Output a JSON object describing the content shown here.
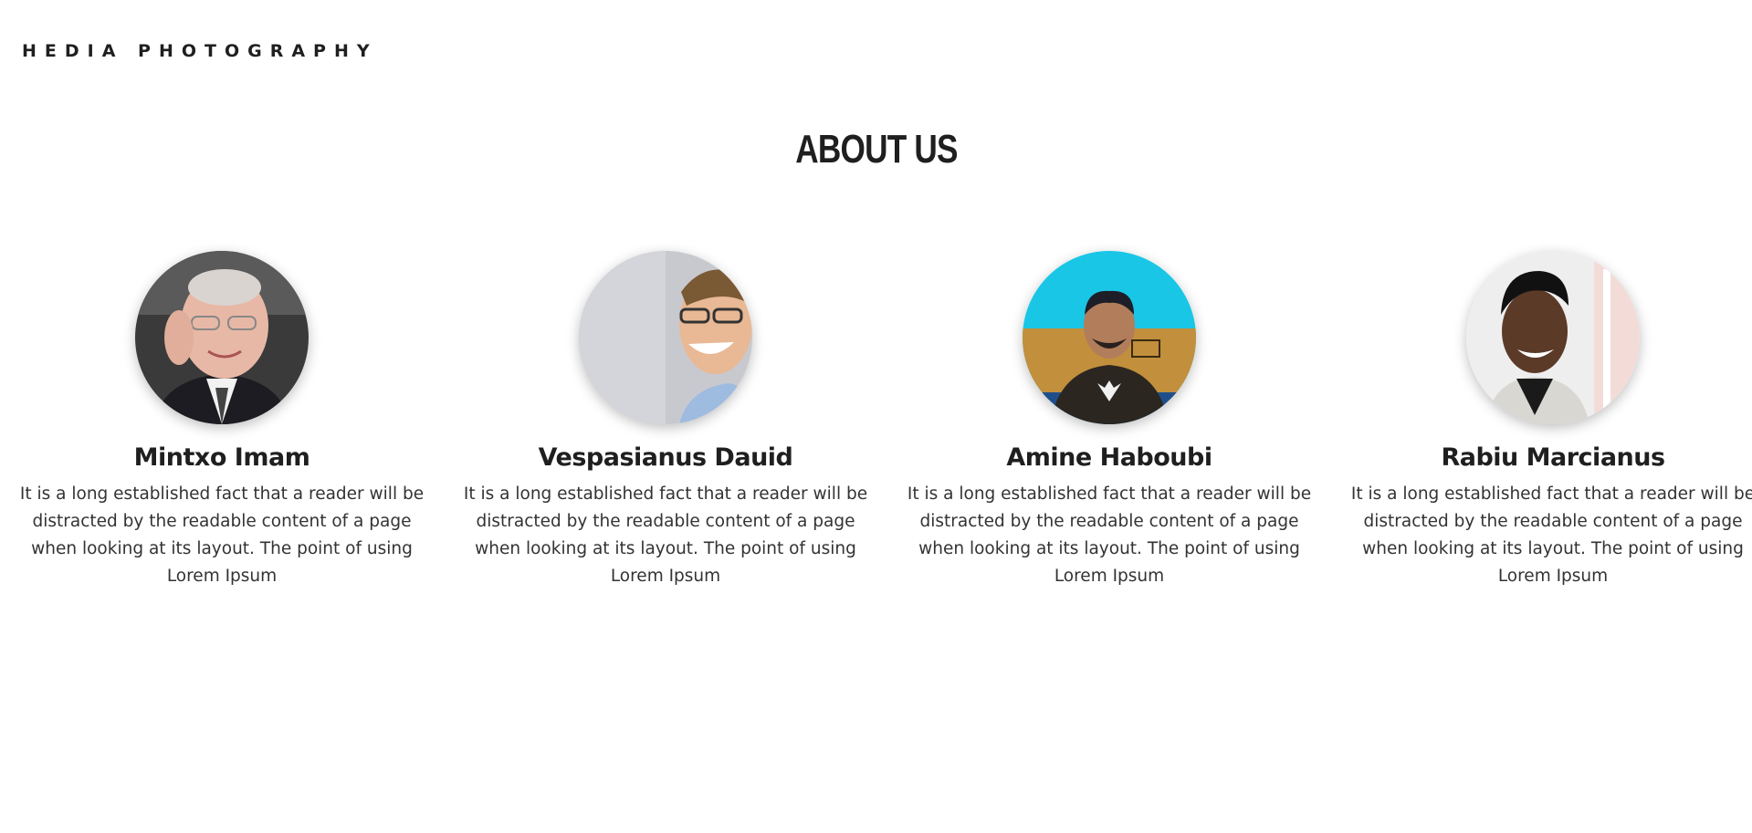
{
  "header": {
    "brand": "HEDIA PHOTOGRAPHY"
  },
  "about": {
    "title": "ABOUT US",
    "members": [
      {
        "name": "Mintxo Imam",
        "bio": "It is a long established fact that a reader will be distracted by the readable content of a page when looking at its layout. The point of using Lorem Ipsum",
        "photo": "portrait-older-man-glasses"
      },
      {
        "name": "Vespasianus Dauid",
        "bio": "It is a long established fact that a reader will be distracted by the readable content of a page when looking at its layout. The point of using Lorem Ipsum",
        "photo": "portrait-smiling-man-glasses"
      },
      {
        "name": "Amine Haboubi",
        "bio": "It is a long established fact that a reader will be distracted by the readable content of a page when looking at its layout. The point of using Lorem Ipsum",
        "photo": "portrait-man-blue-wall"
      },
      {
        "name": "Rabiu Marcianus",
        "bio": "It is a long established fact that a reader will be distracted by the readable content of a page when looking at its layout. The point of using Lorem Ipsum",
        "photo": "portrait-smiling-woman"
      }
    ]
  },
  "colors": {
    "text": "#1f1f1f",
    "background": "#ffffff"
  }
}
